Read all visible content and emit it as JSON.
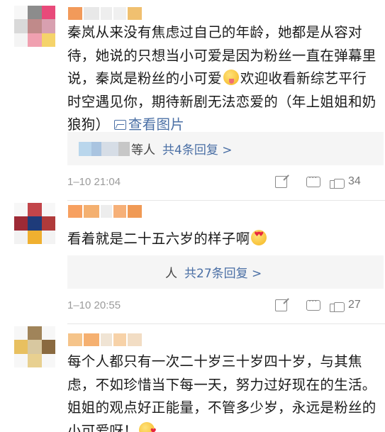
{
  "comments": [
    {
      "avatar_colors": [
        "#f7f7f7",
        "#8c8c8c",
        "#e84a7a",
        "#d9d9d9",
        "#c08a8a",
        "#d8a0b0",
        "#f4f4f4",
        "#f0a0b0",
        "#f5d36a"
      ],
      "name_colors": [
        "#f29a5a",
        "#e8e8e8",
        "#eeeeee",
        "#f0f0f0",
        "#f0c070"
      ],
      "text": "秦岚从来没有焦虑过自己的年龄，她都是从容对待，她说的只想当小可爱是因为粉丝一直在弹幕里说，秦岚是粉丝的小可爱",
      "emoji": "tongue-emoji",
      "text_after": "欢迎收看新综艺平行时空遇见你，期待新剧无法恋爱的（年上姐姐和奶狼狗）",
      "view_pics": "查看图片",
      "reply_blur_colors": [
        "#b9d6ec",
        "#a9c4e0",
        "#d6dde6",
        "#c7c7c7"
      ],
      "reply_who": "等人",
      "reply_count": "共4条回复 >",
      "time": "1–10 21:04",
      "likes": "34"
    },
    {
      "avatar_colors": [
        "#f7f7f7",
        "#c2454a",
        "#f7f7f7",
        "#9e2a36",
        "#1e3b7a",
        "#b03a3a",
        "#f2f2f2",
        "#f0b030",
        "#f3f3f3"
      ],
      "name_colors": [
        "#f7a060",
        "#f4b070",
        "#ededed",
        "#f6b078",
        "#f09a55"
      ],
      "text": "看着就是二十五六岁的样子啊",
      "emoji": "heart-eyes-emoji",
      "reply_who": "人",
      "reply_count": "共27条回复 >",
      "time": "1–10 20:55",
      "likes": "27"
    },
    {
      "avatar_colors": [
        "#f7f7f7",
        "#a0845a",
        "#f7f7f7",
        "#e8c060",
        "#d8c8a0",
        "#8a6a40",
        "#f7f7f7",
        "#e8d090",
        "#f7f7f7"
      ],
      "name_colors": [
        "#f5c48a",
        "#f5b070",
        "#f0e4d4",
        "#f7d2a8",
        "#f2ddc4"
      ],
      "text": "每个人都只有一次二十岁三十岁四十岁，与其焦虑，不如珍惜当下每一天，努力过好现在的生活。姐姐的观点好正能量，不管多少岁，永远是粉丝的小可爱呀！",
      "emoji": "kiss-emoji"
    }
  ]
}
